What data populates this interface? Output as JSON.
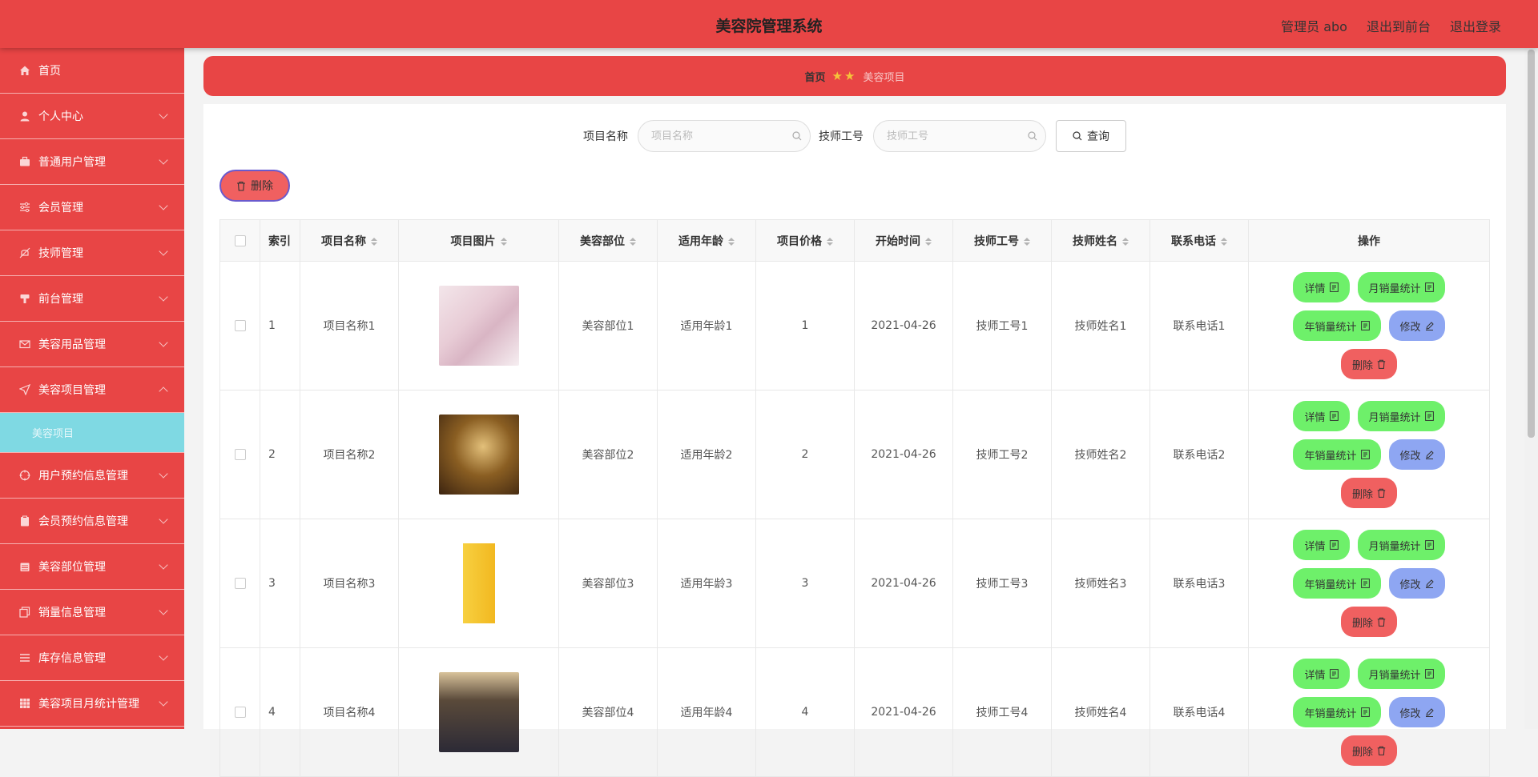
{
  "header": {
    "title": "美容院管理系统",
    "admin": "管理员 abo",
    "to_front": "退出到前台",
    "logout": "退出登录"
  },
  "sidebar": {
    "items": [
      {
        "label": "首页",
        "icon": "home-icon"
      },
      {
        "label": "个人中心",
        "icon": "user-icon"
      },
      {
        "label": "普通用户管理",
        "icon": "briefcase-icon"
      },
      {
        "label": "会员管理",
        "icon": "sliders-icon"
      },
      {
        "label": "技师管理",
        "icon": "no-bell-icon"
      },
      {
        "label": "前台管理",
        "icon": "cup-icon"
      },
      {
        "label": "美容用品管理",
        "icon": "mail-icon"
      },
      {
        "label": "美容项目管理",
        "icon": "send-icon"
      }
    ],
    "sub_item": "美容项目",
    "items_after": [
      {
        "label": "用户预约信息管理",
        "icon": "target-icon"
      },
      {
        "label": "会员预约信息管理",
        "icon": "clipboard-icon"
      },
      {
        "label": "美容部位管理",
        "icon": "calendar-icon"
      },
      {
        "label": "销量信息管理",
        "icon": "copy-icon"
      },
      {
        "label": "库存信息管理",
        "icon": "list-icon"
      },
      {
        "label": "美容项目月统计管理",
        "icon": "grid-icon"
      }
    ]
  },
  "breadcrumb": {
    "home": "首页",
    "current": "美容项目"
  },
  "search": {
    "name_label": "项目名称",
    "name_placeholder": "项目名称",
    "tech_label": "技师工号",
    "tech_placeholder": "技师工号",
    "query": "查询"
  },
  "toolbar": {
    "delete": "删除"
  },
  "table": {
    "headers": {
      "index": "索引",
      "name": "项目名称",
      "image": "项目图片",
      "part": "美容部位",
      "age": "适用年龄",
      "price": "项目价格",
      "start": "开始时间",
      "tech_id": "技师工号",
      "tech_name": "技师姓名",
      "phone": "联系电话",
      "ops": "操作"
    },
    "rows": [
      {
        "index": "1",
        "name": "项目名称1",
        "part": "美容部位1",
        "age": "适用年龄1",
        "price": "1",
        "start": "2021-04-26",
        "tech_id": "技师工号1",
        "tech_name": "技师姓名1",
        "phone": "联系电话1"
      },
      {
        "index": "2",
        "name": "项目名称2",
        "part": "美容部位2",
        "age": "适用年龄2",
        "price": "2",
        "start": "2021-04-26",
        "tech_id": "技师工号2",
        "tech_name": "技师姓名2",
        "phone": "联系电话2"
      },
      {
        "index": "3",
        "name": "项目名称3",
        "part": "美容部位3",
        "age": "适用年龄3",
        "price": "3",
        "start": "2021-04-26",
        "tech_id": "技师工号3",
        "tech_name": "技师姓名3",
        "phone": "联系电话3"
      },
      {
        "index": "4",
        "name": "项目名称4",
        "part": "美容部位4",
        "age": "适用年龄4",
        "price": "4",
        "start": "2021-04-26",
        "tech_id": "技师工号4",
        "tech_name": "技师姓名4",
        "phone": "联系电话4"
      }
    ],
    "actions": {
      "detail": "详情",
      "monthly": "月销量统计",
      "yearly": "年销量统计",
      "edit": "修改",
      "delete": "删除"
    }
  },
  "colors": {
    "accent": "#e84545",
    "submenu_active": "#7fd9e3",
    "green_button": "#6ef06a",
    "blue_button": "#8ea6f2",
    "red_button": "#f06060"
  }
}
